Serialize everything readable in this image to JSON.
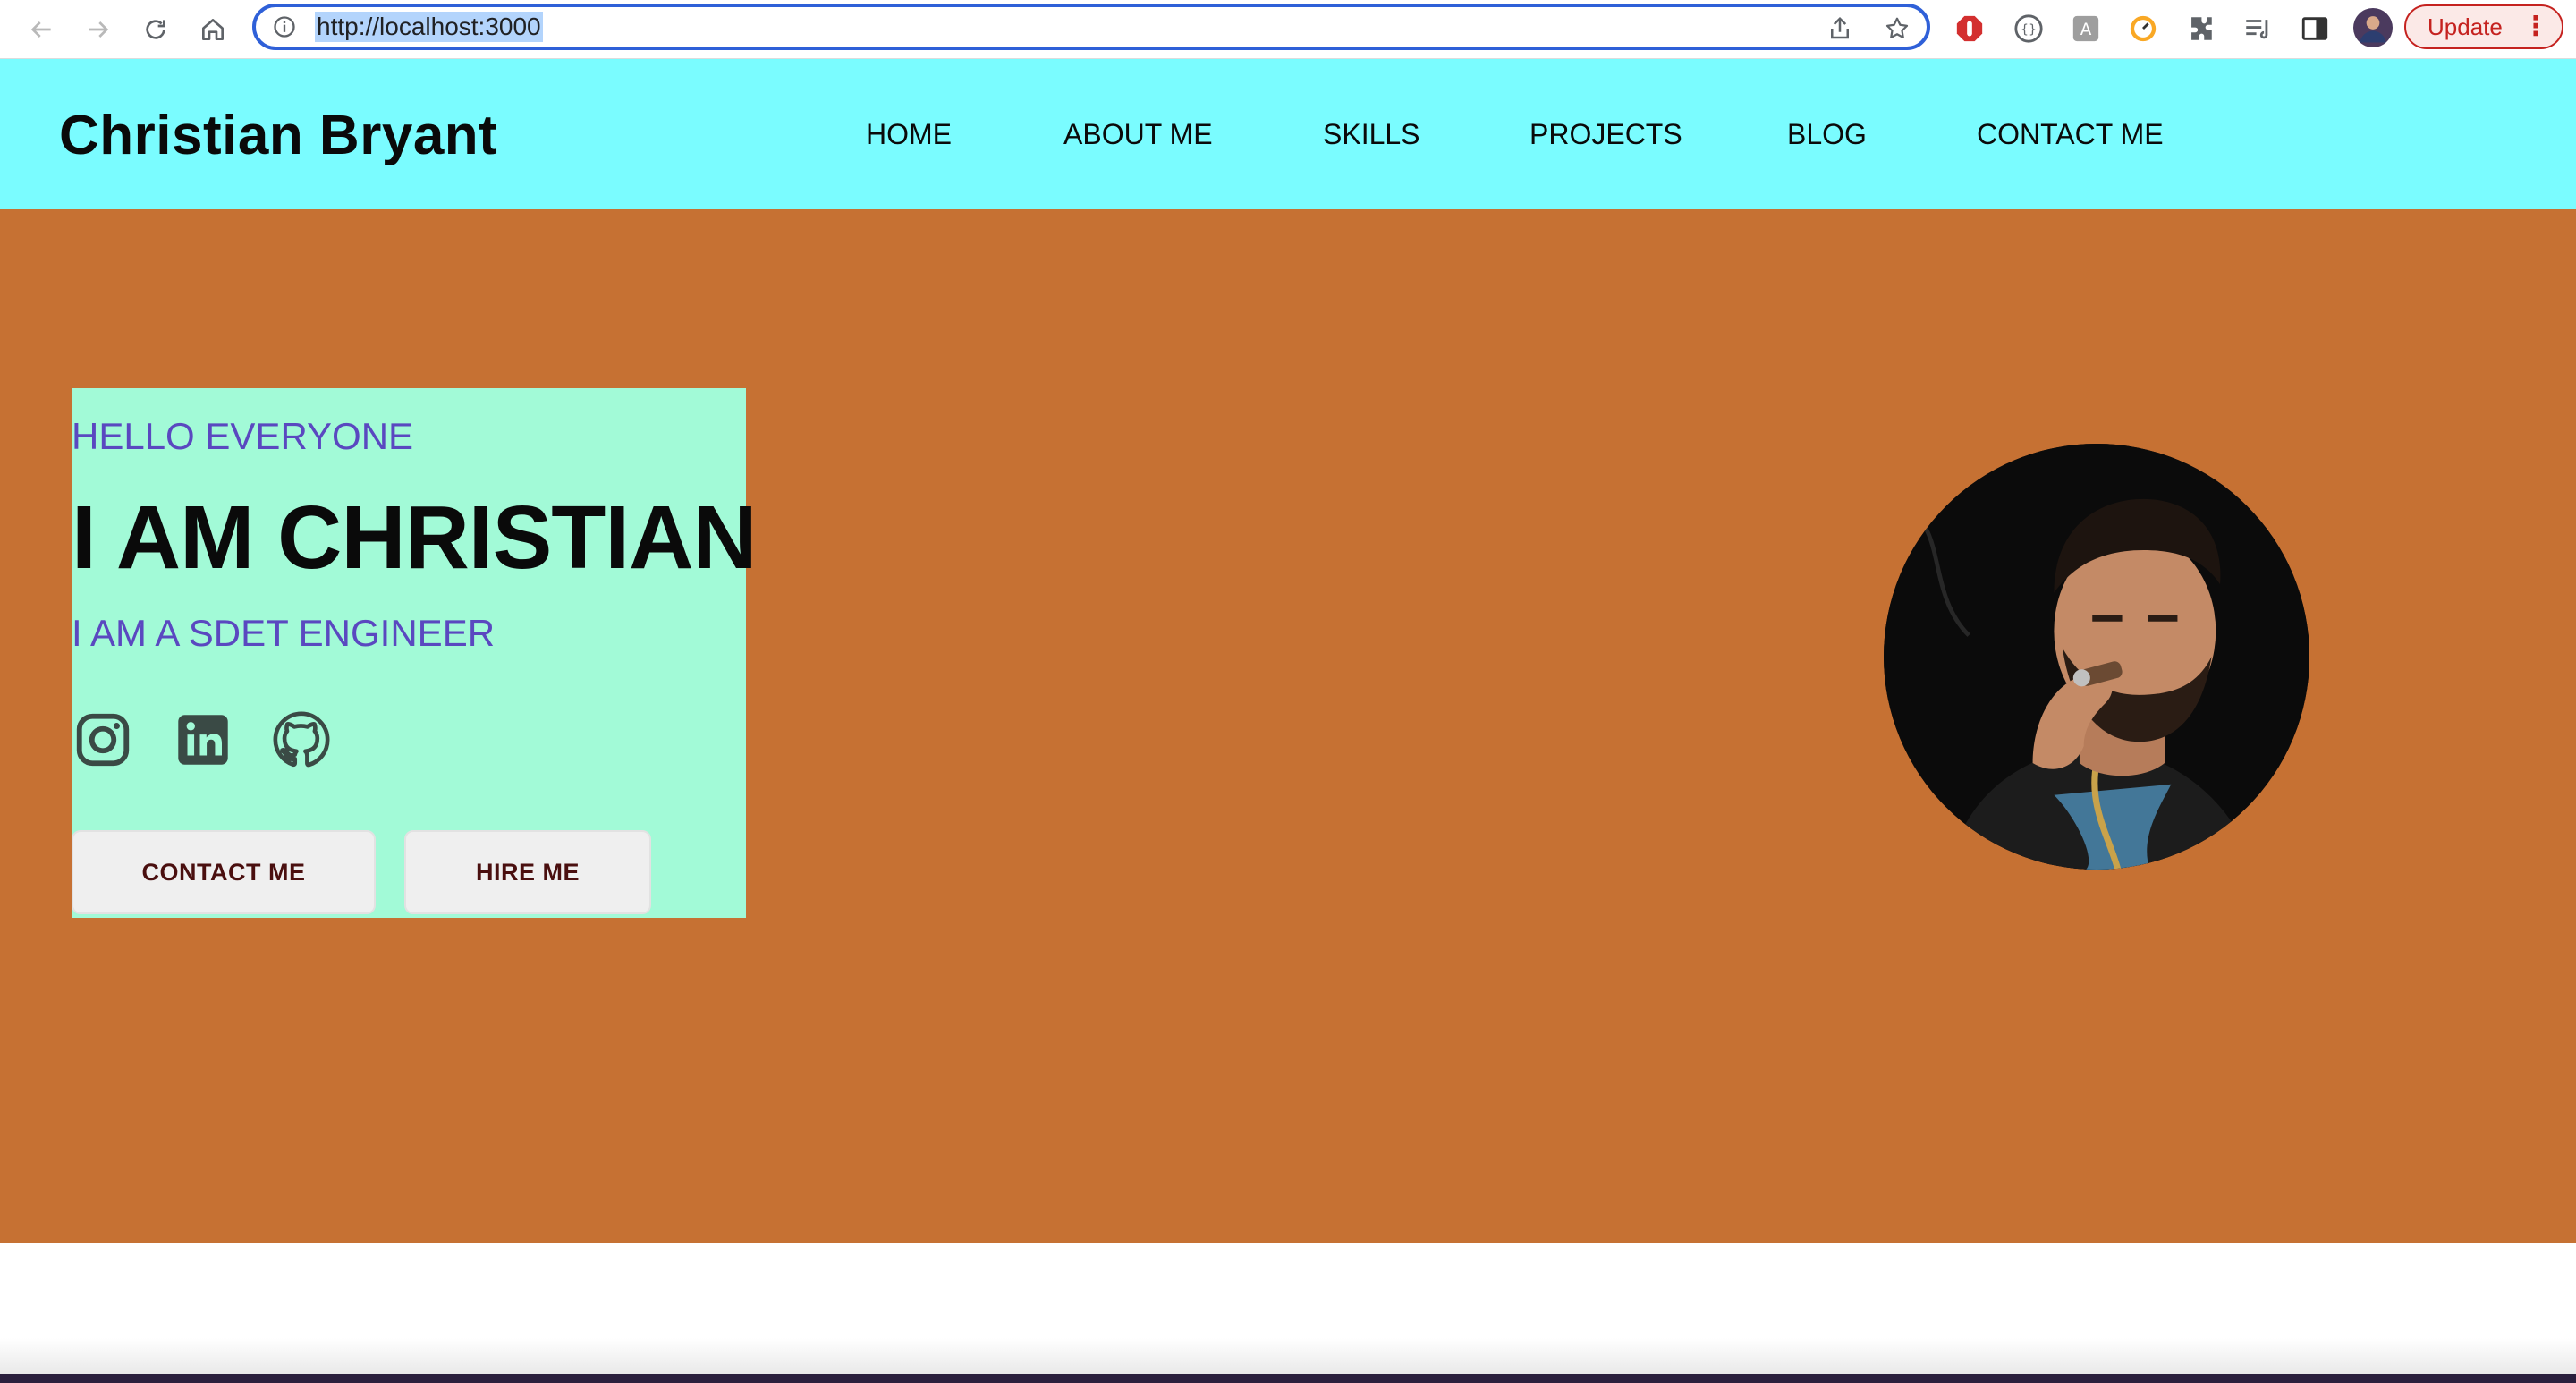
{
  "browser": {
    "url": "http://localhost:3000",
    "update_label": "Update",
    "menu_glyph": "⋮",
    "icons": [
      "back-icon",
      "forward-icon",
      "reload-icon",
      "home-icon",
      "site-info-icon",
      "share-icon",
      "bookmark-star-icon",
      "adblock-extension-icon",
      "code-extension-icon",
      "translate-extension-icon",
      "gauge-extension-icon",
      "extensions-puzzle-icon",
      "reading-list-icon",
      "side-panel-icon",
      "profile-avatar-icon"
    ]
  },
  "site": {
    "brand": "Christian Bryant",
    "nav": [
      {
        "label": "HOME"
      },
      {
        "label": "ABOUT ME"
      },
      {
        "label": "SKILLS"
      },
      {
        "label": "PROJECTS"
      },
      {
        "label": "BLOG"
      },
      {
        "label": "CONTACT ME"
      }
    ]
  },
  "hero": {
    "greeting": "HELLO EVERYONE",
    "headline": "I AM CHRISTIAN",
    "role": "I AM A SDET ENGINEER",
    "social": [
      "instagram-icon",
      "linkedin-icon",
      "github-icon"
    ],
    "buttons": {
      "contact": "CONTACT ME",
      "hire": "HIRE ME"
    }
  },
  "colors": {
    "header_bg": "#7afcff",
    "hero_bg": "#c67133",
    "card_bg": "#a2fad7",
    "accent_text": "#5a48c0",
    "button_text": "#4a0f0f",
    "update_red": "#c5221f"
  }
}
